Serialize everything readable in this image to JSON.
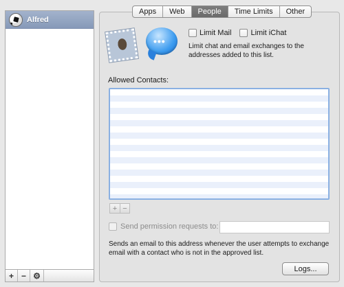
{
  "sidebar": {
    "users": [
      {
        "name": "Alfred",
        "selected": true,
        "avatar_icon": "soccer-ball-icon"
      }
    ],
    "toolbar": {
      "add_label": "+",
      "remove_label": "−",
      "gear_label": "⚙"
    }
  },
  "tabs": [
    {
      "label": "Apps",
      "active": false
    },
    {
      "label": "Web",
      "active": false
    },
    {
      "label": "People",
      "active": true
    },
    {
      "label": "Time Limits",
      "active": false
    },
    {
      "label": "Other",
      "active": false
    }
  ],
  "people": {
    "icons": [
      "mail-stamp-icon",
      "ichat-bubble-icon"
    ],
    "limit_mail_label": "Limit Mail",
    "limit_mail_checked": false,
    "limit_ichat_label": "Limit iChat",
    "limit_ichat_checked": false,
    "limit_description": "Limit chat and email exchanges to the addresses added to this list.",
    "allowed_contacts_title": "Allowed Contacts:",
    "allowed_contacts": [],
    "add_contact_label": "+",
    "remove_contact_label": "−",
    "send_permission_label": "Send permission requests to:",
    "send_permission_checked": false,
    "send_permission_value": "",
    "send_description": "Sends an email to this address whenever the user attempts to exchange email with a contact who is not in the approved list.",
    "logs_button_label": "Logs..."
  },
  "colors": {
    "selection": "#8ea1bf",
    "active_tab": "#707070",
    "list_stripe": "#eaf0fb",
    "focus_ring": "#8ab0e2"
  }
}
